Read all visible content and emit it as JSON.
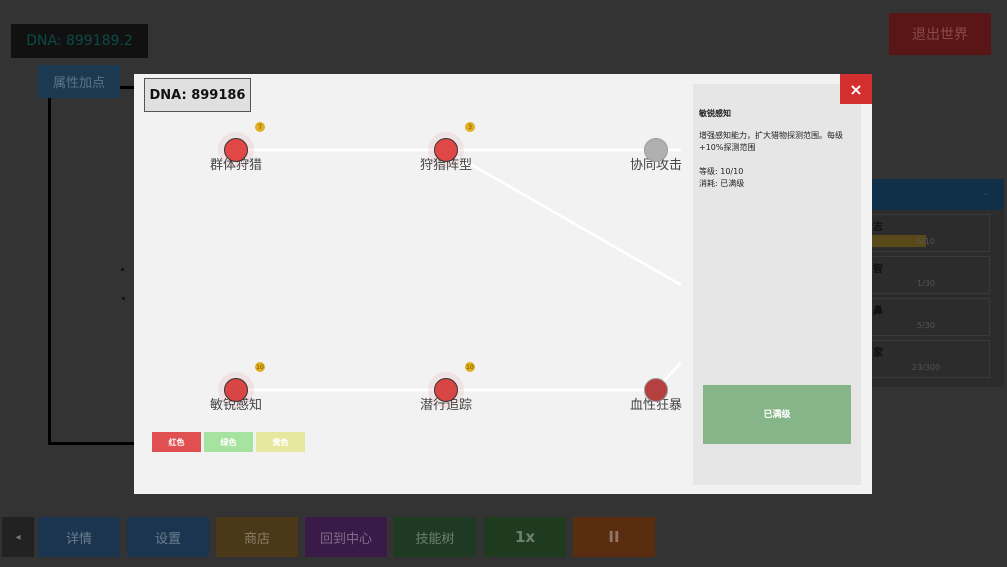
{
  "top": {
    "dna": "DNA: 899189.2",
    "attr_button": "属性加点",
    "exit_button": "退出世界"
  },
  "right_panel": {
    "header_button": "-",
    "stats": [
      {
        "name": "志",
        "value": "5/10",
        "fill": 0.5
      },
      {
        "name": "智",
        "value": "1/30",
        "fill": 0
      },
      {
        "name": "鼻",
        "value": "5/30",
        "fill": 0
      },
      {
        "name": "家",
        "value": "23/300",
        "fill": 0
      }
    ]
  },
  "modal": {
    "dna": "DNA: 899186",
    "close": "×",
    "nodes": [
      {
        "label": "群体狩猎",
        "badge": "7",
        "color": "#e04848"
      },
      {
        "label": "狩猎阵型",
        "badge": "3",
        "color": "#e04848"
      },
      {
        "label": "协同攻击",
        "badge": null,
        "color": "#b0b0b0"
      },
      {
        "label": "敏锐感知",
        "badge": "10",
        "color": "#d84545"
      },
      {
        "label": "潜行追踪",
        "badge": "10",
        "color": "#d84545"
      },
      {
        "label": "血性狂暴",
        "badge": null,
        "color": "#b54040"
      }
    ],
    "legend": [
      {
        "label": "红色",
        "color": "#e05050"
      },
      {
        "label": "绿色",
        "color": "#a6e3a0"
      },
      {
        "label": "黄色",
        "color": "#e6e8a0"
      }
    ],
    "info": {
      "title": "敏锐感知",
      "description": "增强感知能力，扩大猎物探测范围。每级+10%探测范围",
      "level": "等级: 10/10",
      "cost": "消耗: 已满级",
      "button": "已满级"
    }
  },
  "bottom_bar": {
    "collapse": "◂",
    "buttons": [
      {
        "label": "详情",
        "color": "#1b3550"
      },
      {
        "label": "设置",
        "color": "#1b3550"
      },
      {
        "label": "商店",
        "color": "#4a3818"
      },
      {
        "label": "回到中心",
        "color": "#3a1a48"
      },
      {
        "label": "技能树",
        "color": "#1e3a22"
      },
      {
        "label": "1x",
        "color": "#1f3b1f"
      },
      {
        "label": "II",
        "color": "#5a2c10"
      }
    ]
  }
}
